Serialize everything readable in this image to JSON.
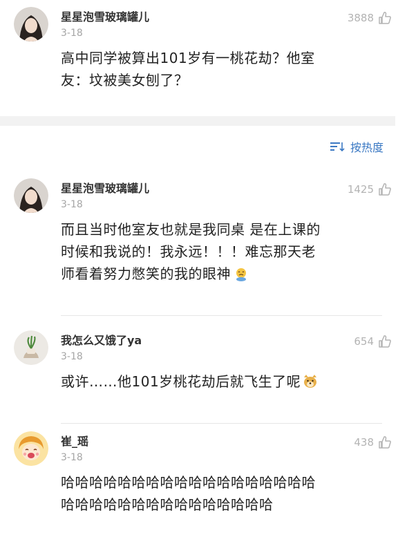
{
  "post": {
    "author": "星星泡雪玻璃罐儿",
    "date": "3-18",
    "likes": "3888",
    "text_line1": "高中同学被算出101岁有一桃花劫？他室",
    "text_line2": "友：坟被美女刨了？"
  },
  "sort": {
    "label": "按热度",
    "icon": "sort-icon"
  },
  "comments": [
    {
      "author": "星星泡雪玻璃罐儿",
      "date": "3-18",
      "likes": "1425",
      "lines": [
        "而且当时他室友也就是我同桌 是在上课的",
        "时候和我说的！我永远！！！难忘那天老",
        "师看着努力憋笑的我的眼神"
      ],
      "emoji": "crying-face-emoji"
    },
    {
      "author": "我怎么又饿了ya",
      "date": "3-18",
      "likes": "654",
      "lines": [
        "或许……他101岁桃花劫后就飞生了呢"
      ],
      "emoji": "doge-emoji"
    },
    {
      "author": "崔_瑶",
      "date": "3-18",
      "likes": "438",
      "lines": [
        "哈哈哈哈哈哈哈哈哈哈哈哈哈哈哈哈哈哈",
        "哈哈哈哈哈哈哈哈哈哈哈哈哈哈哈"
      ]
    }
  ],
  "colors": {
    "link_blue": "#3a78c3",
    "muted_gray": "#a6a6a6",
    "band_gray": "#f2f2f2"
  }
}
